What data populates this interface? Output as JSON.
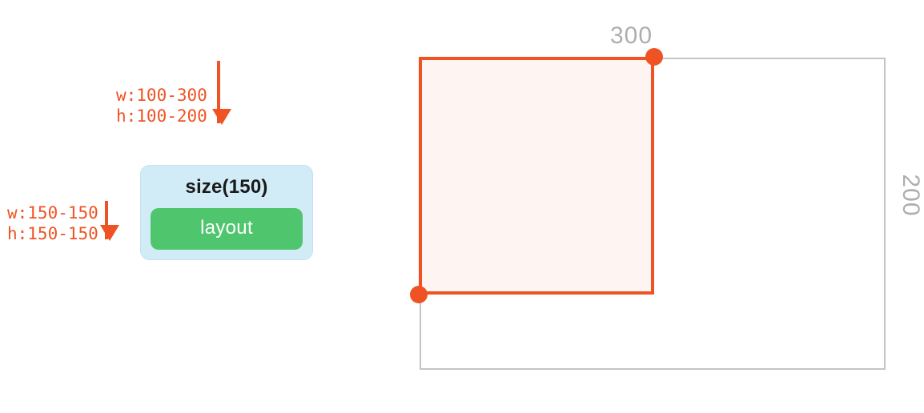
{
  "arrows": {
    "incoming": {
      "w": "w:100-300",
      "h": "h:100-200"
    },
    "outgoing": {
      "w": "w:150-150",
      "h": "h:150-150"
    }
  },
  "node": {
    "title": "size(150)",
    "child_label": "layout"
  },
  "diagram": {
    "outer": {
      "width_label": "300",
      "height_label": "200"
    },
    "constraints": {
      "min_width": 100,
      "max_width": 300,
      "min_height": 100,
      "max_height": 200,
      "fixed_size": 150
    }
  },
  "colors": {
    "accent": "#ef5323",
    "node_bg": "#d2ecf7",
    "child_bg": "#4fc66d",
    "dim_text": "#aeaeae"
  }
}
